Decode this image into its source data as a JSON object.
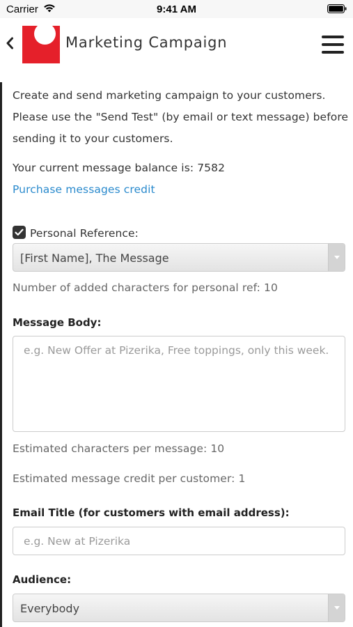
{
  "status_bar": {
    "carrier": "Carrier",
    "time": "9:41 AM"
  },
  "nav": {
    "title": "Marketing Campaign",
    "logo_color": "#e5202a"
  },
  "intro": {
    "line1": "Create and send marketing campaign to your customers.",
    "line2": "Please use the \"Send Test\" (by email or text message) before",
    "line3": "sending it to your customers."
  },
  "balance": {
    "text": "Your current message balance is: 7582",
    "purchase_link": "Purchase messages credit"
  },
  "personal_reference": {
    "label": "Personal Reference:",
    "checked": true,
    "selected": "[First Name], The Message",
    "added_chars": "Number of added characters for personal ref: 10"
  },
  "message_body": {
    "label": "Message Body:",
    "placeholder": "e.g. New Offer at Pizerika, Free toppings, only this week.",
    "estimated_chars": "Estimated characters per message: 10",
    "estimated_credit": "Estimated message credit per customer: 1"
  },
  "email_title": {
    "label": "Email Title (for customers with email address):",
    "placeholder": "e.g. New at Pizerika"
  },
  "audience": {
    "label": "Audience:",
    "selected": "Everybody"
  },
  "colors": {
    "link": "#2a8acd",
    "checkbox": "#333333"
  }
}
